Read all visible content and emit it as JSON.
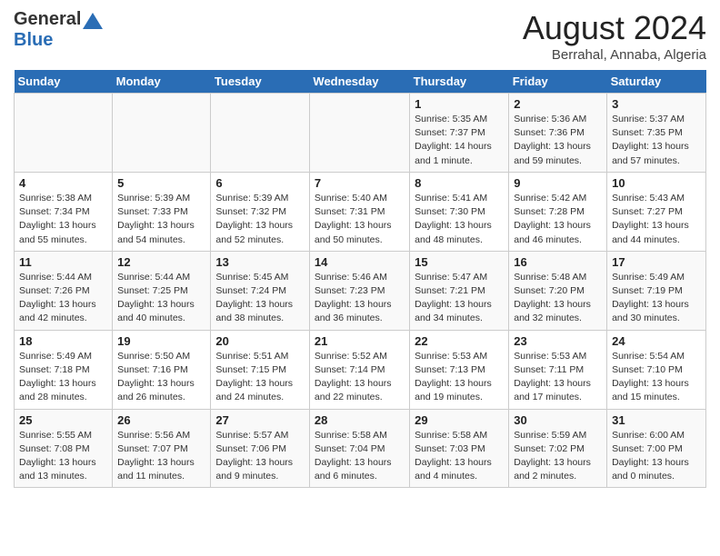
{
  "header": {
    "logo_general": "General",
    "logo_blue": "Blue",
    "title": "August 2024",
    "subtitle": "Berrahal, Annaba, Algeria"
  },
  "days_of_week": [
    "Sunday",
    "Monday",
    "Tuesday",
    "Wednesday",
    "Thursday",
    "Friday",
    "Saturday"
  ],
  "weeks": [
    [
      {
        "day": "",
        "info": ""
      },
      {
        "day": "",
        "info": ""
      },
      {
        "day": "",
        "info": ""
      },
      {
        "day": "",
        "info": ""
      },
      {
        "day": "1",
        "info": "Sunrise: 5:35 AM\nSunset: 7:37 PM\nDaylight: 14 hours\nand 1 minute."
      },
      {
        "day": "2",
        "info": "Sunrise: 5:36 AM\nSunset: 7:36 PM\nDaylight: 13 hours\nand 59 minutes."
      },
      {
        "day": "3",
        "info": "Sunrise: 5:37 AM\nSunset: 7:35 PM\nDaylight: 13 hours\nand 57 minutes."
      }
    ],
    [
      {
        "day": "4",
        "info": "Sunrise: 5:38 AM\nSunset: 7:34 PM\nDaylight: 13 hours\nand 55 minutes."
      },
      {
        "day": "5",
        "info": "Sunrise: 5:39 AM\nSunset: 7:33 PM\nDaylight: 13 hours\nand 54 minutes."
      },
      {
        "day": "6",
        "info": "Sunrise: 5:39 AM\nSunset: 7:32 PM\nDaylight: 13 hours\nand 52 minutes."
      },
      {
        "day": "7",
        "info": "Sunrise: 5:40 AM\nSunset: 7:31 PM\nDaylight: 13 hours\nand 50 minutes."
      },
      {
        "day": "8",
        "info": "Sunrise: 5:41 AM\nSunset: 7:30 PM\nDaylight: 13 hours\nand 48 minutes."
      },
      {
        "day": "9",
        "info": "Sunrise: 5:42 AM\nSunset: 7:28 PM\nDaylight: 13 hours\nand 46 minutes."
      },
      {
        "day": "10",
        "info": "Sunrise: 5:43 AM\nSunset: 7:27 PM\nDaylight: 13 hours\nand 44 minutes."
      }
    ],
    [
      {
        "day": "11",
        "info": "Sunrise: 5:44 AM\nSunset: 7:26 PM\nDaylight: 13 hours\nand 42 minutes."
      },
      {
        "day": "12",
        "info": "Sunrise: 5:44 AM\nSunset: 7:25 PM\nDaylight: 13 hours\nand 40 minutes."
      },
      {
        "day": "13",
        "info": "Sunrise: 5:45 AM\nSunset: 7:24 PM\nDaylight: 13 hours\nand 38 minutes."
      },
      {
        "day": "14",
        "info": "Sunrise: 5:46 AM\nSunset: 7:23 PM\nDaylight: 13 hours\nand 36 minutes."
      },
      {
        "day": "15",
        "info": "Sunrise: 5:47 AM\nSunset: 7:21 PM\nDaylight: 13 hours\nand 34 minutes."
      },
      {
        "day": "16",
        "info": "Sunrise: 5:48 AM\nSunset: 7:20 PM\nDaylight: 13 hours\nand 32 minutes."
      },
      {
        "day": "17",
        "info": "Sunrise: 5:49 AM\nSunset: 7:19 PM\nDaylight: 13 hours\nand 30 minutes."
      }
    ],
    [
      {
        "day": "18",
        "info": "Sunrise: 5:49 AM\nSunset: 7:18 PM\nDaylight: 13 hours\nand 28 minutes."
      },
      {
        "day": "19",
        "info": "Sunrise: 5:50 AM\nSunset: 7:16 PM\nDaylight: 13 hours\nand 26 minutes."
      },
      {
        "day": "20",
        "info": "Sunrise: 5:51 AM\nSunset: 7:15 PM\nDaylight: 13 hours\nand 24 minutes."
      },
      {
        "day": "21",
        "info": "Sunrise: 5:52 AM\nSunset: 7:14 PM\nDaylight: 13 hours\nand 22 minutes."
      },
      {
        "day": "22",
        "info": "Sunrise: 5:53 AM\nSunset: 7:13 PM\nDaylight: 13 hours\nand 19 minutes."
      },
      {
        "day": "23",
        "info": "Sunrise: 5:53 AM\nSunset: 7:11 PM\nDaylight: 13 hours\nand 17 minutes."
      },
      {
        "day": "24",
        "info": "Sunrise: 5:54 AM\nSunset: 7:10 PM\nDaylight: 13 hours\nand 15 minutes."
      }
    ],
    [
      {
        "day": "25",
        "info": "Sunrise: 5:55 AM\nSunset: 7:08 PM\nDaylight: 13 hours\nand 13 minutes."
      },
      {
        "day": "26",
        "info": "Sunrise: 5:56 AM\nSunset: 7:07 PM\nDaylight: 13 hours\nand 11 minutes."
      },
      {
        "day": "27",
        "info": "Sunrise: 5:57 AM\nSunset: 7:06 PM\nDaylight: 13 hours\nand 9 minutes."
      },
      {
        "day": "28",
        "info": "Sunrise: 5:58 AM\nSunset: 7:04 PM\nDaylight: 13 hours\nand 6 minutes."
      },
      {
        "day": "29",
        "info": "Sunrise: 5:58 AM\nSunset: 7:03 PM\nDaylight: 13 hours\nand 4 minutes."
      },
      {
        "day": "30",
        "info": "Sunrise: 5:59 AM\nSunset: 7:02 PM\nDaylight: 13 hours\nand 2 minutes."
      },
      {
        "day": "31",
        "info": "Sunrise: 6:00 AM\nSunset: 7:00 PM\nDaylight: 13 hours\nand 0 minutes."
      }
    ]
  ]
}
